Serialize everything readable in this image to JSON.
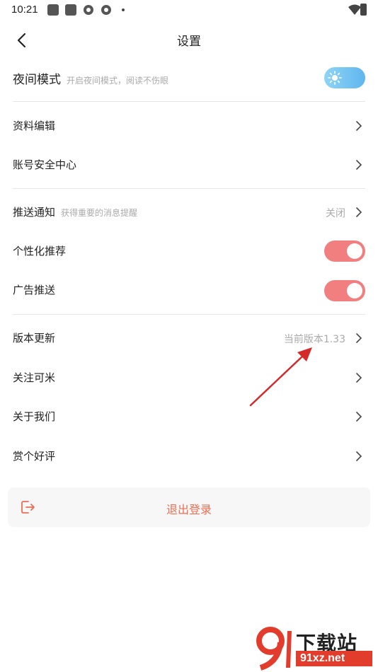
{
  "status_bar": {
    "time": "10:21"
  },
  "header": {
    "title": "设置"
  },
  "night_mode": {
    "label": "夜间模式",
    "sub": "开启夜间模式，阅读不伤眼",
    "enabled": false
  },
  "section1": [
    {
      "label": "资料编辑"
    },
    {
      "label": "账号安全中心"
    }
  ],
  "push": {
    "label": "推送通知",
    "sub": "获得重要的消息提醒",
    "value": "关闭"
  },
  "personalized": {
    "label": "个性化推荐",
    "enabled": true
  },
  "ads": {
    "label": "广告推送",
    "enabled": true
  },
  "version": {
    "label": "版本更新",
    "value": "当前版本1.33"
  },
  "section3": [
    {
      "label": "关注可米"
    },
    {
      "label": "关于我们"
    },
    {
      "label": "赏个好评"
    }
  ],
  "logout": {
    "label": "退出登录"
  },
  "watermark": {
    "text": "下载站",
    "url": "91xz.net"
  },
  "colors": {
    "accent": "#f27f7f",
    "logout_text": "#ee6e52",
    "night_toggle": "#5fb6ef",
    "arrow": "#d42a2a"
  },
  "icons": {
    "back": "chevron-left-icon",
    "row": "chevron-right-icon",
    "logout": "logout-icon",
    "night": "sun-icon"
  }
}
